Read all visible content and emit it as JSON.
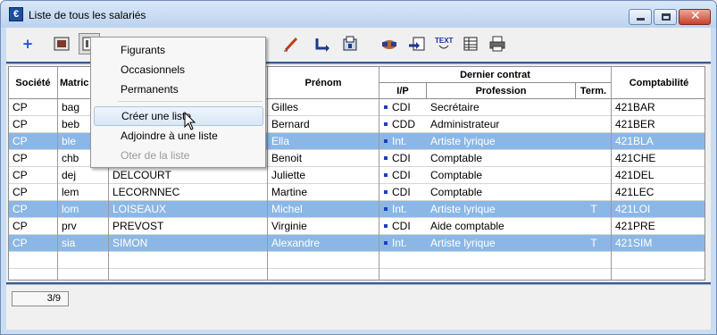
{
  "window": {
    "title": "Liste de tous les salariés",
    "app_icon": "€"
  },
  "toolbar": {
    "icons": [
      "add-icon",
      "view-card-icon",
      "figurants-icon",
      "edit-icon",
      "refresh-icon",
      "export-icon",
      "handshake-icon",
      "import-icon",
      "text-icon",
      "table-icon",
      "printer-icon"
    ]
  },
  "columns": {
    "societe": "Société",
    "matricule": "Matric",
    "nom": "",
    "prenom": "Prénom",
    "dernier_contrat": "Dernier contrat",
    "ip": "I/P",
    "profession": "Profession",
    "term": "Term.",
    "comptabilite": "Comptabilité"
  },
  "rows": [
    {
      "societe": "CP",
      "matricule": "bag",
      "nom": "",
      "prenom": "Gilles",
      "ip": "CDI",
      "profession": "Secrétaire",
      "term": "",
      "compta": "421BAR",
      "selected": false
    },
    {
      "societe": "CP",
      "matricule": "beb",
      "nom": "",
      "prenom": "Bernard",
      "ip": "CDD",
      "profession": "Administrateur",
      "term": "",
      "compta": "421BER",
      "selected": false
    },
    {
      "societe": "CP",
      "matricule": "ble",
      "nom": "",
      "prenom": "Ella",
      "ip": "Int.",
      "profession": "Artiste lyrique",
      "term": "",
      "compta": "421BLA",
      "selected": true
    },
    {
      "societe": "CP",
      "matricule": "chb",
      "nom": "",
      "prenom": "Benoit",
      "ip": "CDI",
      "profession": "Comptable",
      "term": "",
      "compta": "421CHE",
      "selected": false
    },
    {
      "societe": "CP",
      "matricule": "dej",
      "nom": "DELCOURT",
      "prenom": "Juliette",
      "ip": "CDI",
      "profession": "Comptable",
      "term": "",
      "compta": "421DEL",
      "selected": false
    },
    {
      "societe": "CP",
      "matricule": "lem",
      "nom": "LECORNNEC",
      "prenom": "Martine",
      "ip": "CDI",
      "profession": "Comptable",
      "term": "",
      "compta": "421LEC",
      "selected": false
    },
    {
      "societe": "CP",
      "matricule": "lom",
      "nom": "LOISEAUX",
      "prenom": "Michel",
      "ip": "Int.",
      "profession": "Artiste lyrique",
      "term": "T",
      "compta": "421LOI",
      "selected": true
    },
    {
      "societe": "CP",
      "matricule": "prv",
      "nom": "PREVOST",
      "prenom": "Virginie",
      "ip": "CDI",
      "profession": "Aide comptable",
      "term": "",
      "compta": "421PRE",
      "selected": false
    },
    {
      "societe": "CP",
      "matricule": "sia",
      "nom": "SIMON",
      "prenom": "Alexandre",
      "ip": "Int.",
      "profession": "Artiste lyrique",
      "term": "T",
      "compta": "421SIM",
      "selected": true
    }
  ],
  "context_menu": {
    "items": [
      {
        "label": "Figurants",
        "state": "normal"
      },
      {
        "label": "Occasionnels",
        "state": "normal"
      },
      {
        "label": "Permanents",
        "state": "normal"
      },
      {
        "label": "Créer une liste",
        "state": "hover"
      },
      {
        "label": "Adjoindre à une liste",
        "state": "normal"
      },
      {
        "label": "Oter de la liste",
        "state": "disabled"
      }
    ]
  },
  "status": {
    "count": "3/9"
  },
  "colors": {
    "selection": "#8bb7e6",
    "accent": "#3b5a8f",
    "bullet": "#1f3fbf"
  }
}
